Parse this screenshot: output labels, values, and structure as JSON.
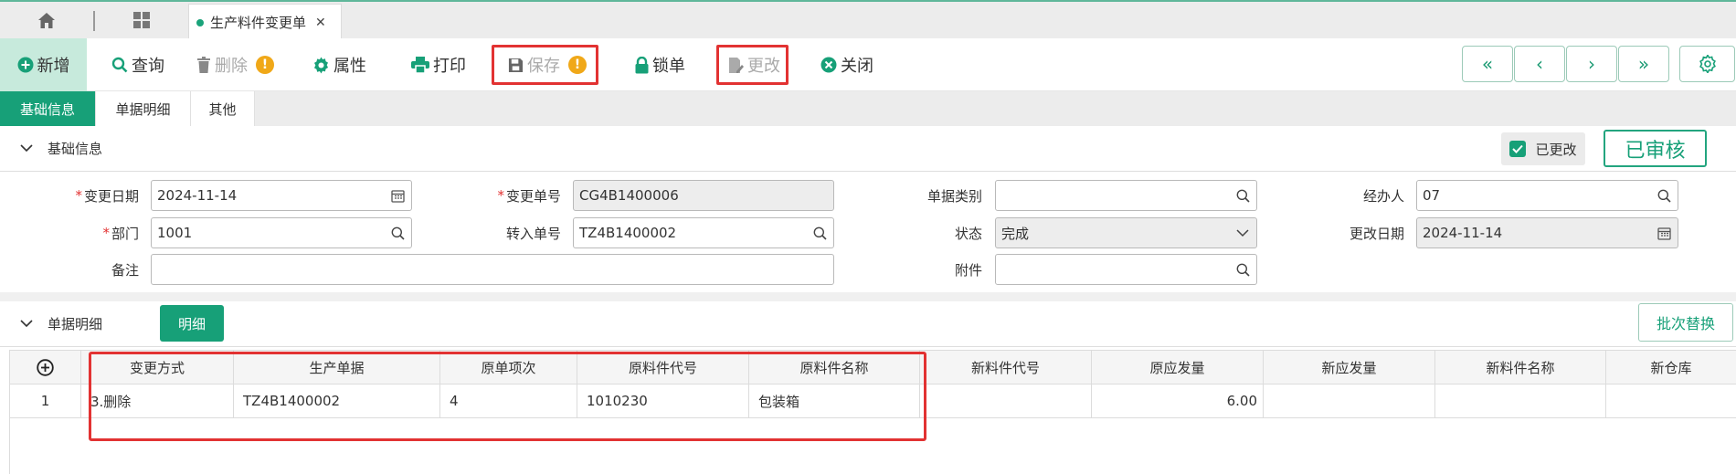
{
  "tabbar": {
    "active_tab": "生产料件变更单",
    "close_glyph": "✕"
  },
  "toolbar": {
    "new": "新增",
    "query": "查询",
    "delete": "删除",
    "property": "属性",
    "print": "打印",
    "save": "保存",
    "lock": "锁单",
    "modify": "更改",
    "close": "关闭",
    "warn_glyph": "!"
  },
  "nav": {
    "first": "«",
    "prev": "‹",
    "next": "›",
    "last": "»"
  },
  "subtabs": [
    "基础信息",
    "单据明细",
    "其他"
  ],
  "basic": {
    "title": "基础信息",
    "edited_label": "已更改",
    "audit_label": "已审核",
    "fields": {
      "change_date_label": "变更日期",
      "change_date": "2024-11-14",
      "change_no_label": "变更单号",
      "change_no": "CG4B1400006",
      "doc_type_label": "单据类别",
      "doc_type": "",
      "handler_label": "经办人",
      "handler": "07",
      "dept_label": "部门",
      "dept": "1001",
      "transfer_no_label": "转入单号",
      "transfer_no": "TZ4B1400002",
      "status_label": "状态",
      "status": "完成",
      "modify_date_label": "更改日期",
      "modify_date": "2024-11-14",
      "remark_label": "备注",
      "remark": "",
      "attachment_label": "附件",
      "attachment": ""
    },
    "required_mark": "*"
  },
  "detail": {
    "title": "单据明细",
    "detail_button": "明细",
    "batch_button": "批次替换",
    "columns": [
      "变更方式",
      "生产单据",
      "原单项次",
      "原料件代号",
      "原料件名称",
      "新料件代号",
      "原应发量",
      "新应发量",
      "新料件名称",
      "新仓库"
    ],
    "rows": [
      {
        "no": "1",
        "cells": [
          "3.删除",
          "TZ4B1400002",
          "4",
          "1010230",
          "包装箱",
          "",
          "6.00",
          "",
          "",
          ""
        ]
      }
    ]
  }
}
